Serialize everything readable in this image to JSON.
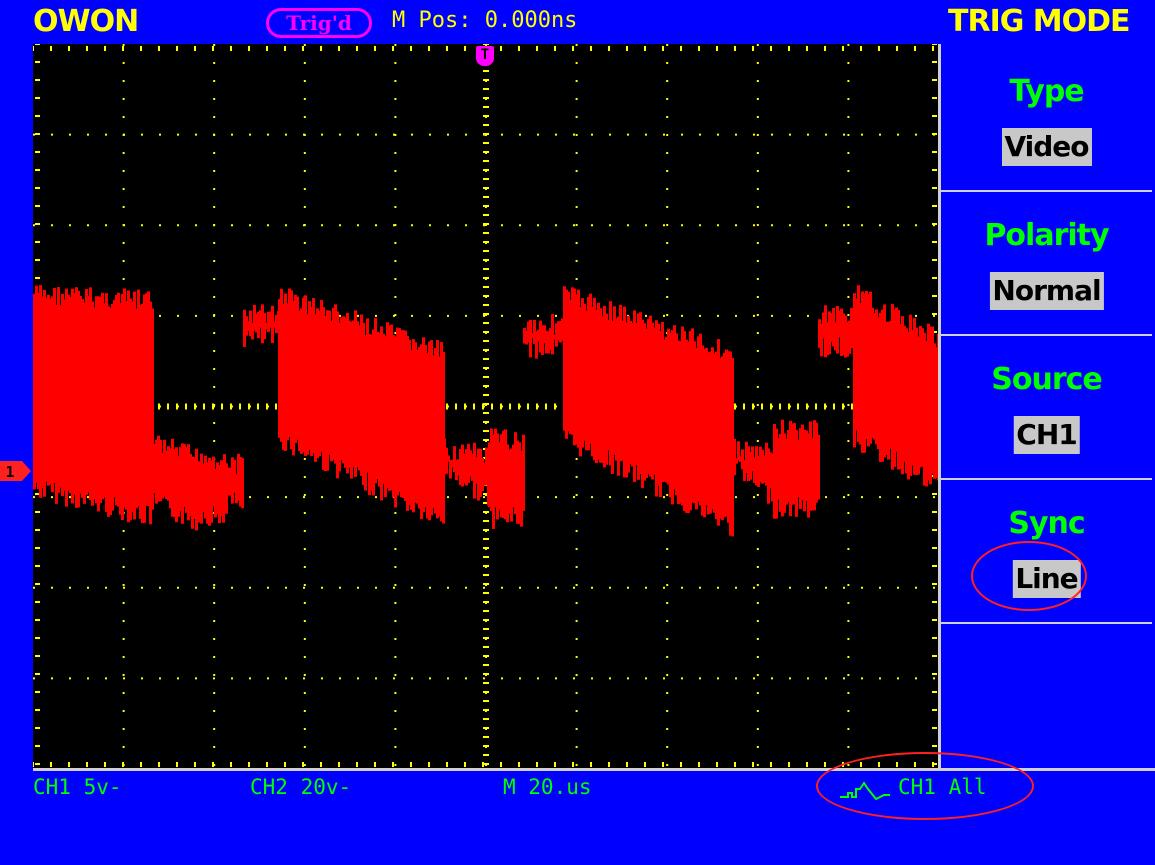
{
  "header": {
    "brand": "OWON",
    "trigger_status": "Trig'd",
    "m_pos": "M Pos: 0.000ns",
    "menu_title": "TRIG MODE"
  },
  "markers": {
    "trigger_position": "T",
    "ch1_ground": "1"
  },
  "menu": [
    {
      "label": "Type",
      "value": "Video"
    },
    {
      "label": "Polarity",
      "value": "Normal"
    },
    {
      "label": "Source",
      "value": "CH1"
    },
    {
      "label": "Sync",
      "value": "Line"
    }
  ],
  "status_bar": {
    "ch1": "CH1 5v-",
    "ch2": "CH2 20v-",
    "timebase": "M 20.us",
    "trigger_info": "CH1 All",
    "trigger_icon": "video-trigger-icon"
  },
  "colors": {
    "background": "#0000ff",
    "screen": "#000000",
    "grid": "#ffff00",
    "waveform": "#ff0000",
    "label": "#00ff00",
    "title": "#ffff00",
    "trigger_badge": "#ff00ff",
    "annotation": "#ff2020"
  }
}
